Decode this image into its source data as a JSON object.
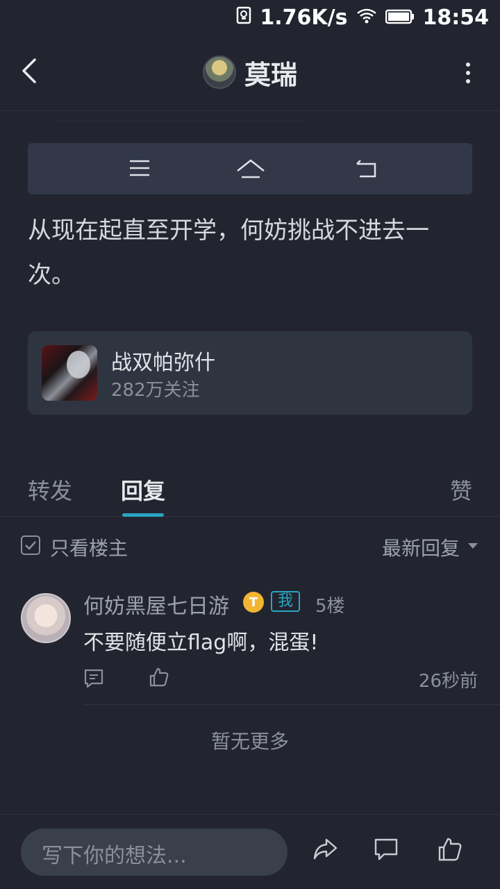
{
  "status_bar": {
    "speed": "1.76K/s",
    "time": "18:54"
  },
  "header": {
    "title": "莫瑞"
  },
  "post": {
    "text": "从现在起直至开学，何妨挑战不进去一次。"
  },
  "forum": {
    "name": "战双帕弥什",
    "followers": "282万关注"
  },
  "tabs": [
    {
      "label": "转发"
    },
    {
      "label": "回复"
    },
    {
      "label": "赞"
    }
  ],
  "filter": {
    "only_op_label": "只看楼主",
    "sort_label": "最新回复"
  },
  "comment": {
    "author": "何妨黑屋七日游",
    "level_badge": "T",
    "me_badge": "我",
    "floor": "5楼",
    "text": "不要随便立flag啊，混蛋!",
    "time": "26秒前"
  },
  "footer": {
    "no_more": "暂无更多"
  },
  "input": {
    "placeholder": "写下你的想法..."
  },
  "colors": {
    "background": "#22252f",
    "accent": "#2aa4c3",
    "card": "#2f3441"
  }
}
